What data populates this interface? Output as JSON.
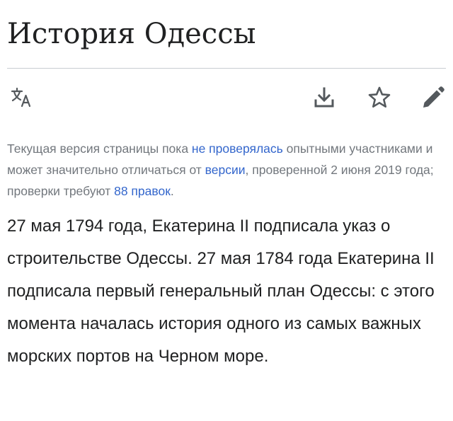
{
  "page": {
    "title": "История Одессы"
  },
  "toolbar": {
    "language_icon": "translate-icon",
    "download_icon": "download-icon",
    "watch_icon": "star-icon",
    "edit_icon": "pencil-icon",
    "icon_color": "#54595d"
  },
  "notice": {
    "part1": "Текущая версия страницы пока ",
    "link_not_reviewed": "не проверялась",
    "part2": " опытными участниками и может значительно отличаться от ",
    "link_version": "версии",
    "part3": ", проверенной 2 июня 2019 года; проверки требуют ",
    "link_edits": "88 правок",
    "part4": ".",
    "text_color": "#72777d",
    "link_color": "#3366cc"
  },
  "article": {
    "paragraph": "27 мая 1794 года, Екатерина II подписала указ о строительстве Одессы. 27 мая 1784 года Екатерина II подписала первый генеральный план Одессы: с этого момента началась история одного из самых важных морских портов на Черном море."
  }
}
